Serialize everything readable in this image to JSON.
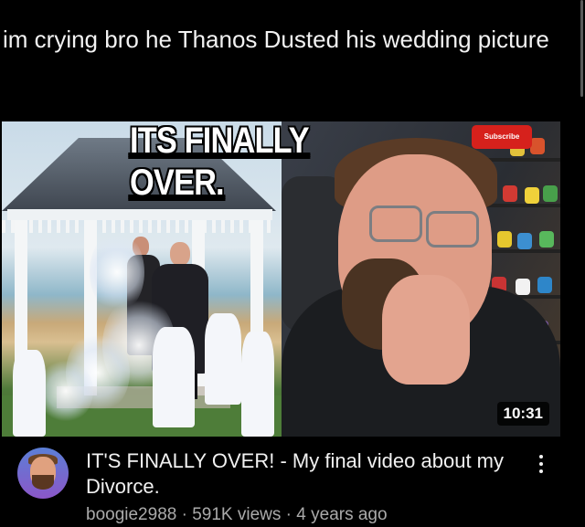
{
  "post": {
    "caption": "im crying bro he Thanos Dusted his wedding picture"
  },
  "video": {
    "thumbnail_headline": "ITS FINALLY OVER.",
    "subscribe_text": "Subscribe",
    "duration": "10:31",
    "title": "IT'S FINALLY OVER! - My final video about my Divorce.",
    "channel": "boogie2988",
    "views": "591K views",
    "age": "4 years ago",
    "separator": "·"
  },
  "icons": {
    "more": "more-vertical-icon",
    "avatar": "channel-avatar"
  },
  "colors": {
    "background": "#000000",
    "subscribe_red": "#d6211c",
    "meta_gray": "#aaaaaa"
  }
}
